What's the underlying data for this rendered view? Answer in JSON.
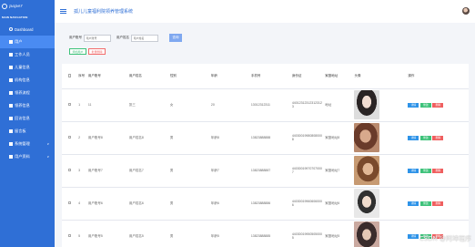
{
  "sidebar": {
    "logo_text": "paper",
    "nav_title": "MAIN NAVIGATION",
    "items": [
      {
        "label": "Dashboard",
        "icon": "circle-icon",
        "active": false,
        "arrow": ""
      },
      {
        "label": "用户",
        "icon": "square-icon",
        "active": true,
        "arrow": ""
      },
      {
        "label": "工作人员",
        "icon": "square-icon",
        "active": false,
        "arrow": ""
      },
      {
        "label": "儿童信息",
        "icon": "square-icon",
        "active": false,
        "arrow": ""
      },
      {
        "label": "机构信息",
        "icon": "square-icon",
        "active": false,
        "arrow": ""
      },
      {
        "label": "领养流程",
        "icon": "square-icon",
        "active": false,
        "arrow": ""
      },
      {
        "label": "领养信息",
        "icon": "square-icon",
        "active": false,
        "arrow": ""
      },
      {
        "label": "回访信息",
        "icon": "square-icon",
        "active": false,
        "arrow": ""
      },
      {
        "label": "留言板",
        "icon": "square-icon",
        "active": false,
        "arrow": ""
      },
      {
        "label": "系统管理",
        "icon": "square-icon",
        "active": false,
        "arrow": "∨"
      },
      {
        "label": "用户资料",
        "icon": "square-icon",
        "active": false,
        "arrow": "∨"
      }
    ]
  },
  "header": {
    "title": "孤儿儿童福利院领养管理系统"
  },
  "search": {
    "account_label": "用户账号",
    "account_placeholder": "用户账号",
    "name_label": "用户姓名",
    "name_placeholder": "用户姓名",
    "query_button": "查询"
  },
  "toolbar": {
    "add_label": "添加用户",
    "batch_delete_label": "批量删除"
  },
  "table": {
    "columns": [
      "序号",
      "用户账号",
      "用户姓名",
      "性别",
      "年龄",
      "手机号",
      "身份证",
      "家庭地址",
      "头像",
      "操作"
    ],
    "op_labels": {
      "detail": "详情",
      "edit": "修改",
      "delete": "删除"
    },
    "rows": [
      {
        "idx": "1",
        "account": "11",
        "name": "张三",
        "sex": "女",
        "age": "20",
        "phone": "13012312311",
        "id_card": "440123123123123123",
        "address": "地址",
        "avatar": "t1"
      },
      {
        "idx": "2",
        "account": "用户账号8",
        "name": "用户姓名8",
        "sex": "男",
        "age": "年龄8",
        "phone": "13823888888",
        "id_card": "440300199808080008",
        "address": "家庭地址8",
        "avatar": "t2"
      },
      {
        "idx": "3",
        "account": "用户账号7",
        "name": "用户姓名7",
        "sex": "男",
        "age": "年龄7",
        "phone": "13823888887",
        "id_card": "440300199707070007",
        "address": "家庭地址7",
        "avatar": "t3"
      },
      {
        "idx": "4",
        "account": "用户账号6",
        "name": "用户姓名6",
        "sex": "男",
        "age": "年龄6",
        "phone": "13823888886",
        "id_card": "440300199606060006",
        "address": "家庭地址6",
        "avatar": "t4"
      },
      {
        "idx": "5",
        "account": "用户账号5",
        "name": "用户姓名5",
        "sex": "男",
        "age": "年龄5",
        "phone": "13823888885",
        "id_card": "440300199505050005",
        "address": "家庭地址5",
        "avatar": "t5"
      }
    ]
  },
  "watermark": "CSDN @阿坤程序"
}
